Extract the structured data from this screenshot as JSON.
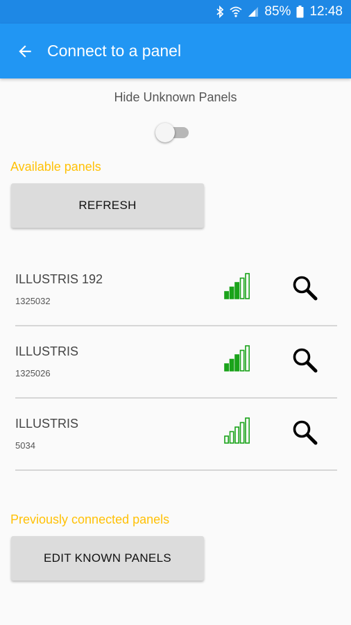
{
  "status_bar": {
    "battery_percent": "85%",
    "time": "12:48",
    "icons": [
      "bluetooth-icon",
      "wifi-icon",
      "cell-signal-icon",
      "battery-icon"
    ]
  },
  "app_bar": {
    "title": "Connect to a panel",
    "back_icon": "arrow-back-icon",
    "color": "#2196f3",
    "status_color": "#1e88e5"
  },
  "filter": {
    "label": "Hide Unknown Panels",
    "enabled": false
  },
  "available": {
    "title": "Available panels",
    "refresh_label": "REFRESH",
    "panels": [
      {
        "name": "ILLUSTRIS 192",
        "id": "1325032",
        "signal_bars_filled": 3,
        "signal_bars_total": 5
      },
      {
        "name": "ILLUSTRIS",
        "id": "1325026",
        "signal_bars_filled": 3,
        "signal_bars_total": 5
      },
      {
        "name": "ILLUSTRIS",
        "id": "5034",
        "signal_bars_filled": 0,
        "signal_bars_total": 5
      }
    ]
  },
  "previous": {
    "title": "Previously connected panels",
    "edit_label": "EDIT KNOWN PANELS"
  },
  "colors": {
    "accent": "#ffc107",
    "signal": "#1aa31a"
  }
}
